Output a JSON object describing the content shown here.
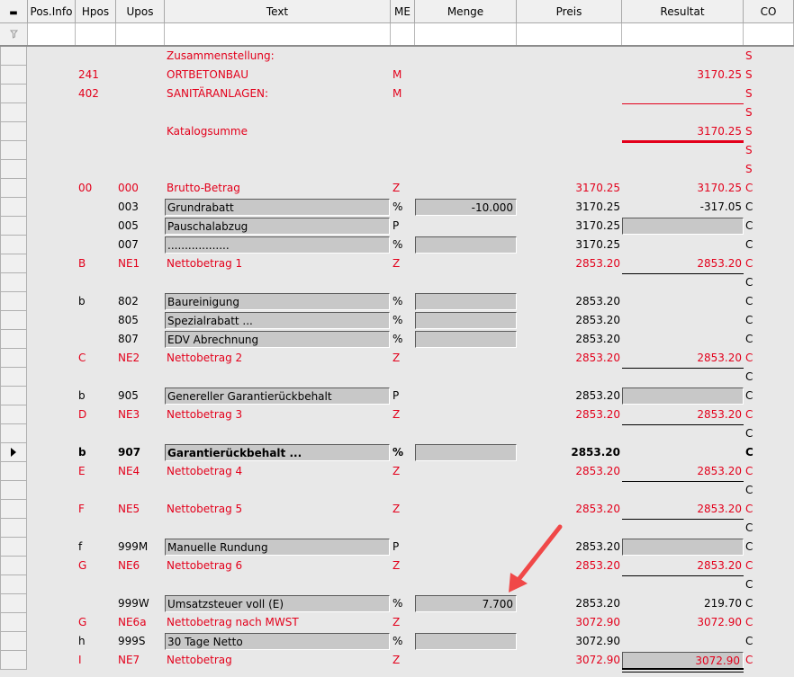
{
  "columns": [
    "Pos.Info",
    "Hpos",
    "Upos",
    "Text",
    "ME",
    "Menge",
    "Preis",
    "Resultat",
    "CO"
  ],
  "header_first": "▬",
  "filter_icon": "funnel-icon",
  "rows": [
    {
      "hpos": "",
      "upos": "",
      "text": "Zusammenstellung:",
      "me": "",
      "menge": "",
      "preis": "",
      "resultat": "",
      "co": "S",
      "red": true
    },
    {
      "hpos": "241",
      "upos": "",
      "text": "ORTBETONBAU",
      "me": "M",
      "menge": "",
      "preis": "",
      "resultat": "3170.25",
      "co": "S",
      "red": true
    },
    {
      "hpos": "402",
      "upos": "",
      "text": "SANITÄRANLAGEN:",
      "me": "M",
      "menge": "",
      "preis": "",
      "resultat": "",
      "co": "S",
      "red": true,
      "line": "thin-red"
    },
    {
      "hpos": "",
      "upos": "",
      "text": "",
      "me": "",
      "menge": "",
      "preis": "",
      "resultat": "",
      "co": "S",
      "red": true
    },
    {
      "hpos": "",
      "upos": "",
      "text": "Katalogsumme",
      "me": "",
      "menge": "",
      "preis": "",
      "resultat": "3170.25",
      "co": "S",
      "red": true,
      "line": "thick-red"
    },
    {
      "hpos": "",
      "upos": "",
      "text": "",
      "me": "",
      "menge": "",
      "preis": "",
      "resultat": "",
      "co": "S",
      "red": true
    },
    {
      "hpos": "",
      "upos": "",
      "text": "",
      "me": "",
      "menge": "",
      "preis": "",
      "resultat": "",
      "co": "S",
      "red": true
    },
    {
      "hpos": "00",
      "upos": "000",
      "text": "Brutto-Betrag",
      "me": "Z",
      "menge": "",
      "preis": "3170.25",
      "resultat": "3170.25",
      "co": "C",
      "red": true
    },
    {
      "hpos": "",
      "upos": "003",
      "text": "Grundrabatt",
      "me": "%",
      "menge": "-10.000",
      "preis": "3170.25",
      "resultat": "-317.05",
      "co": "C",
      "box": true,
      "mbox": true
    },
    {
      "hpos": "",
      "upos": "005",
      "text": "Pauschalabzug",
      "me": "P",
      "menge": "",
      "preis": "3170.25",
      "resultat": "",
      "co": "C",
      "box": true,
      "rbox": true
    },
    {
      "hpos": "",
      "upos": "007",
      "text": "..................",
      "me": "%",
      "menge": "",
      "preis": "3170.25",
      "resultat": "",
      "co": "C",
      "box": true,
      "mbox": true
    },
    {
      "hpos": "B",
      "upos": "NE1",
      "text": "Nettobetrag 1",
      "me": "Z",
      "menge": "",
      "preis": "2853.20",
      "resultat": "2853.20",
      "co": "C",
      "red": true,
      "line": "thin-black"
    },
    {
      "hpos": "",
      "upos": "",
      "text": "",
      "me": "",
      "menge": "",
      "preis": "",
      "resultat": "",
      "co": "C"
    },
    {
      "hpos": "b",
      "upos": "802",
      "text": "Baureinigung",
      "me": "%",
      "menge": "",
      "preis": "2853.20",
      "resultat": "",
      "co": "C",
      "box": true,
      "mbox": true
    },
    {
      "hpos": "",
      "upos": "805",
      "text": "Spezialrabatt ...",
      "me": "%",
      "menge": "",
      "preis": "2853.20",
      "resultat": "",
      "co": "C",
      "box": true,
      "mbox": true
    },
    {
      "hpos": "",
      "upos": "807",
      "text": "EDV Abrechnung",
      "me": "%",
      "menge": "",
      "preis": "2853.20",
      "resultat": "",
      "co": "C",
      "box": true,
      "mbox": true
    },
    {
      "hpos": "C",
      "upos": "NE2",
      "text": "Nettobetrag 2",
      "me": "Z",
      "menge": "",
      "preis": "2853.20",
      "resultat": "2853.20",
      "co": "C",
      "red": true,
      "line": "thin-black"
    },
    {
      "hpos": "",
      "upos": "",
      "text": "",
      "me": "",
      "menge": "",
      "preis": "",
      "resultat": "",
      "co": "C"
    },
    {
      "hpos": "b",
      "upos": "905",
      "text": "Genereller Garantierückbehalt",
      "me": "P",
      "menge": "",
      "preis": "2853.20",
      "resultat": "",
      "co": "C",
      "box": true,
      "rbox": true
    },
    {
      "hpos": "D",
      "upos": "NE3",
      "text": "Nettobetrag 3",
      "me": "Z",
      "menge": "",
      "preis": "2853.20",
      "resultat": "2853.20",
      "co": "C",
      "red": true,
      "line": "thin-black"
    },
    {
      "hpos": "",
      "upos": "",
      "text": "",
      "me": "",
      "menge": "",
      "preis": "",
      "resultat": "",
      "co": "C"
    },
    {
      "hpos": "b",
      "upos": "907",
      "text": "Garantierückbehalt ...",
      "me": "%",
      "menge": "",
      "preis": "2853.20",
      "resultat": "",
      "co": "C",
      "box": true,
      "mbox": true,
      "bold": true,
      "current": true
    },
    {
      "hpos": "E",
      "upos": "NE4",
      "text": "Nettobetrag 4",
      "me": "Z",
      "menge": "",
      "preis": "2853.20",
      "resultat": "2853.20",
      "co": "C",
      "red": true,
      "line": "thin-black"
    },
    {
      "hpos": "",
      "upos": "",
      "text": "",
      "me": "",
      "menge": "",
      "preis": "",
      "resultat": "",
      "co": "C"
    },
    {
      "hpos": "F",
      "upos": "NE5",
      "text": "Nettobetrag 5",
      "me": "Z",
      "menge": "",
      "preis": "2853.20",
      "resultat": "2853.20",
      "co": "C",
      "red": true,
      "line": "thin-black"
    },
    {
      "hpos": "",
      "upos": "",
      "text": "",
      "me": "",
      "menge": "",
      "preis": "",
      "resultat": "",
      "co": "C"
    },
    {
      "hpos": "f",
      "upos": "999M",
      "text": "Manuelle Rundung",
      "me": "P",
      "menge": "",
      "preis": "2853.20",
      "resultat": "",
      "co": "C",
      "box": true,
      "rbox": true
    },
    {
      "hpos": "G",
      "upos": "NE6",
      "text": "Nettobetrag 6",
      "me": "Z",
      "menge": "",
      "preis": "2853.20",
      "resultat": "2853.20",
      "co": "C",
      "red": true,
      "line": "thin-black"
    },
    {
      "hpos": "",
      "upos": "",
      "text": "",
      "me": "",
      "menge": "",
      "preis": "",
      "resultat": "",
      "co": "C"
    },
    {
      "hpos": "",
      "upos": "999W",
      "text": "Umsatzsteuer voll (E)",
      "me": "%",
      "menge": "7.700",
      "preis": "2853.20",
      "resultat": "219.70",
      "co": "C",
      "box": true,
      "mbox": true
    },
    {
      "hpos": "G",
      "upos": "NE6a",
      "text": "Nettobetrag nach MWST",
      "me": "Z",
      "menge": "",
      "preis": "3072.90",
      "resultat": "3072.90",
      "co": "C",
      "red": true
    },
    {
      "hpos": "h",
      "upos": "999S",
      "text": "30 Tage Netto",
      "me": "%",
      "menge": "",
      "preis": "3072.90",
      "resultat": "",
      "co": "C",
      "box": true,
      "mbox": true
    },
    {
      "hpos": "I",
      "upos": "NE7",
      "text": "Nettobetrag",
      "me": "Z",
      "menge": "",
      "preis": "3072.90",
      "resultat": "3072.90",
      "co": "C",
      "red": true,
      "rbox": true,
      "line": "double-black"
    }
  ],
  "annotation": {
    "type": "arrow",
    "color": "#f04848"
  }
}
